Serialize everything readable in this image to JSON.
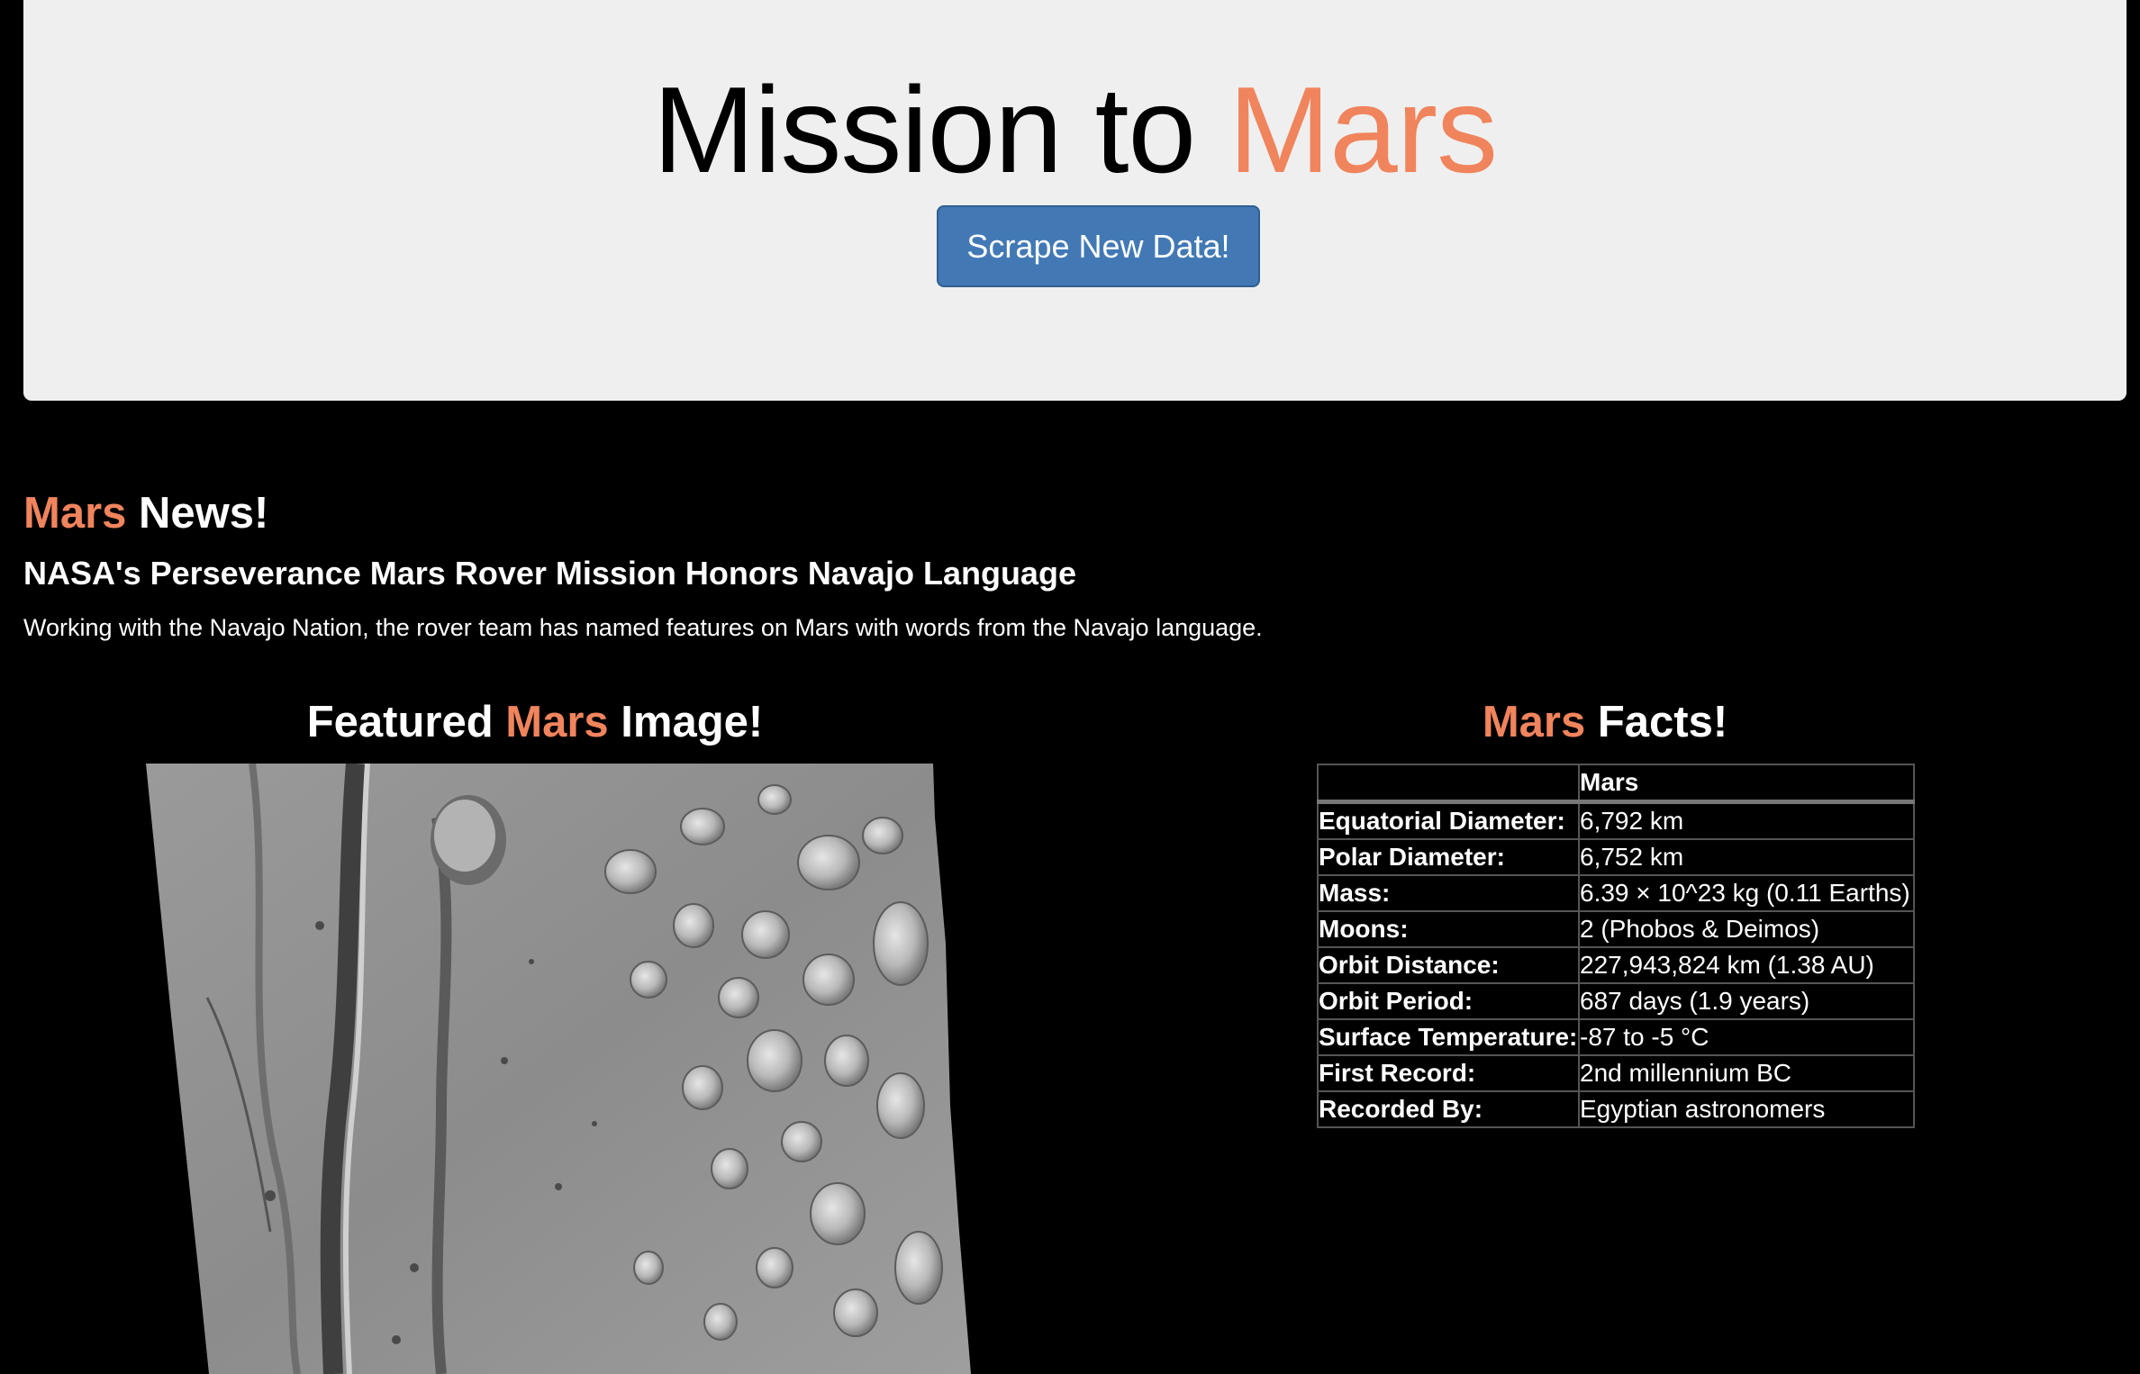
{
  "header": {
    "title_prefix": "Mission to ",
    "title_accent": "Mars",
    "scrape_button_label": "Scrape New Data!"
  },
  "news": {
    "heading_accent": "Mars",
    "heading_suffix": " News!",
    "title": "NASA's Perseverance Mars Rover Mission Honors Navajo Language",
    "teaser": "Working with the Navajo Nation, the rover team has named features on Mars with words from the Navajo language."
  },
  "featured": {
    "heading_prefix": "Featured ",
    "heading_accent": "Mars",
    "heading_suffix": " Image!"
  },
  "facts": {
    "heading_accent": "Mars",
    "heading_suffix": " Facts!",
    "column_header": "Mars",
    "rows": [
      {
        "label": "Equatorial Diameter:",
        "value": "6,792 km"
      },
      {
        "label": "Polar Diameter:",
        "value": "6,752 km"
      },
      {
        "label": "Mass:",
        "value": "6.39 × 10^23 kg (0.11 Earths)"
      },
      {
        "label": "Moons:",
        "value": "2 (Phobos & Deimos)"
      },
      {
        "label": "Orbit Distance:",
        "value": "227,943,824 km (1.38 AU)"
      },
      {
        "label": "Orbit Period:",
        "value": "687 days (1.9 years)"
      },
      {
        "label": "Surface Temperature:",
        "value": "-87 to -5 °C"
      },
      {
        "label": "First Record:",
        "value": "2nd millennium BC"
      },
      {
        "label": "Recorded By:",
        "value": "Egyptian astronomers"
      }
    ]
  },
  "colors": {
    "accent": "#f0845c",
    "button": "#4279b5",
    "jumbotron": "#efefef",
    "background": "#000000"
  }
}
